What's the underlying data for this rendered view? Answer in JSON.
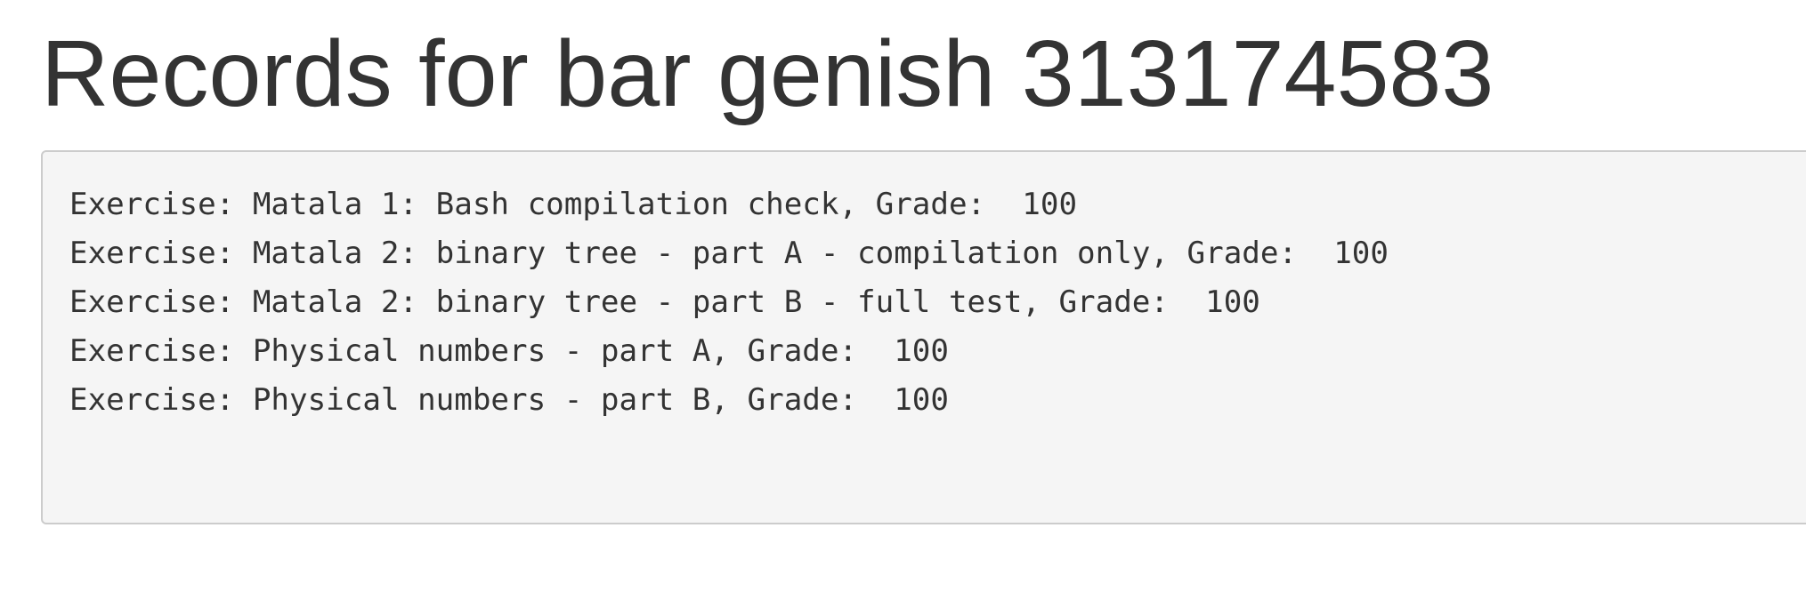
{
  "page": {
    "title": "Records for bar genish 313174583"
  },
  "records": [
    {
      "text": "Exercise: Matala 1: Bash compilation check, Grade:  100"
    },
    {
      "text": "Exercise: Matala 2: binary tree - part A - compilation only, Grade:  100"
    },
    {
      "text": "Exercise: Matala 2: binary tree - part B - full test, Grade:  100"
    },
    {
      "text": "Exercise: Physical numbers - part A, Grade:  100"
    },
    {
      "text": "Exercise: Physical numbers - part B, Grade:  100"
    }
  ]
}
